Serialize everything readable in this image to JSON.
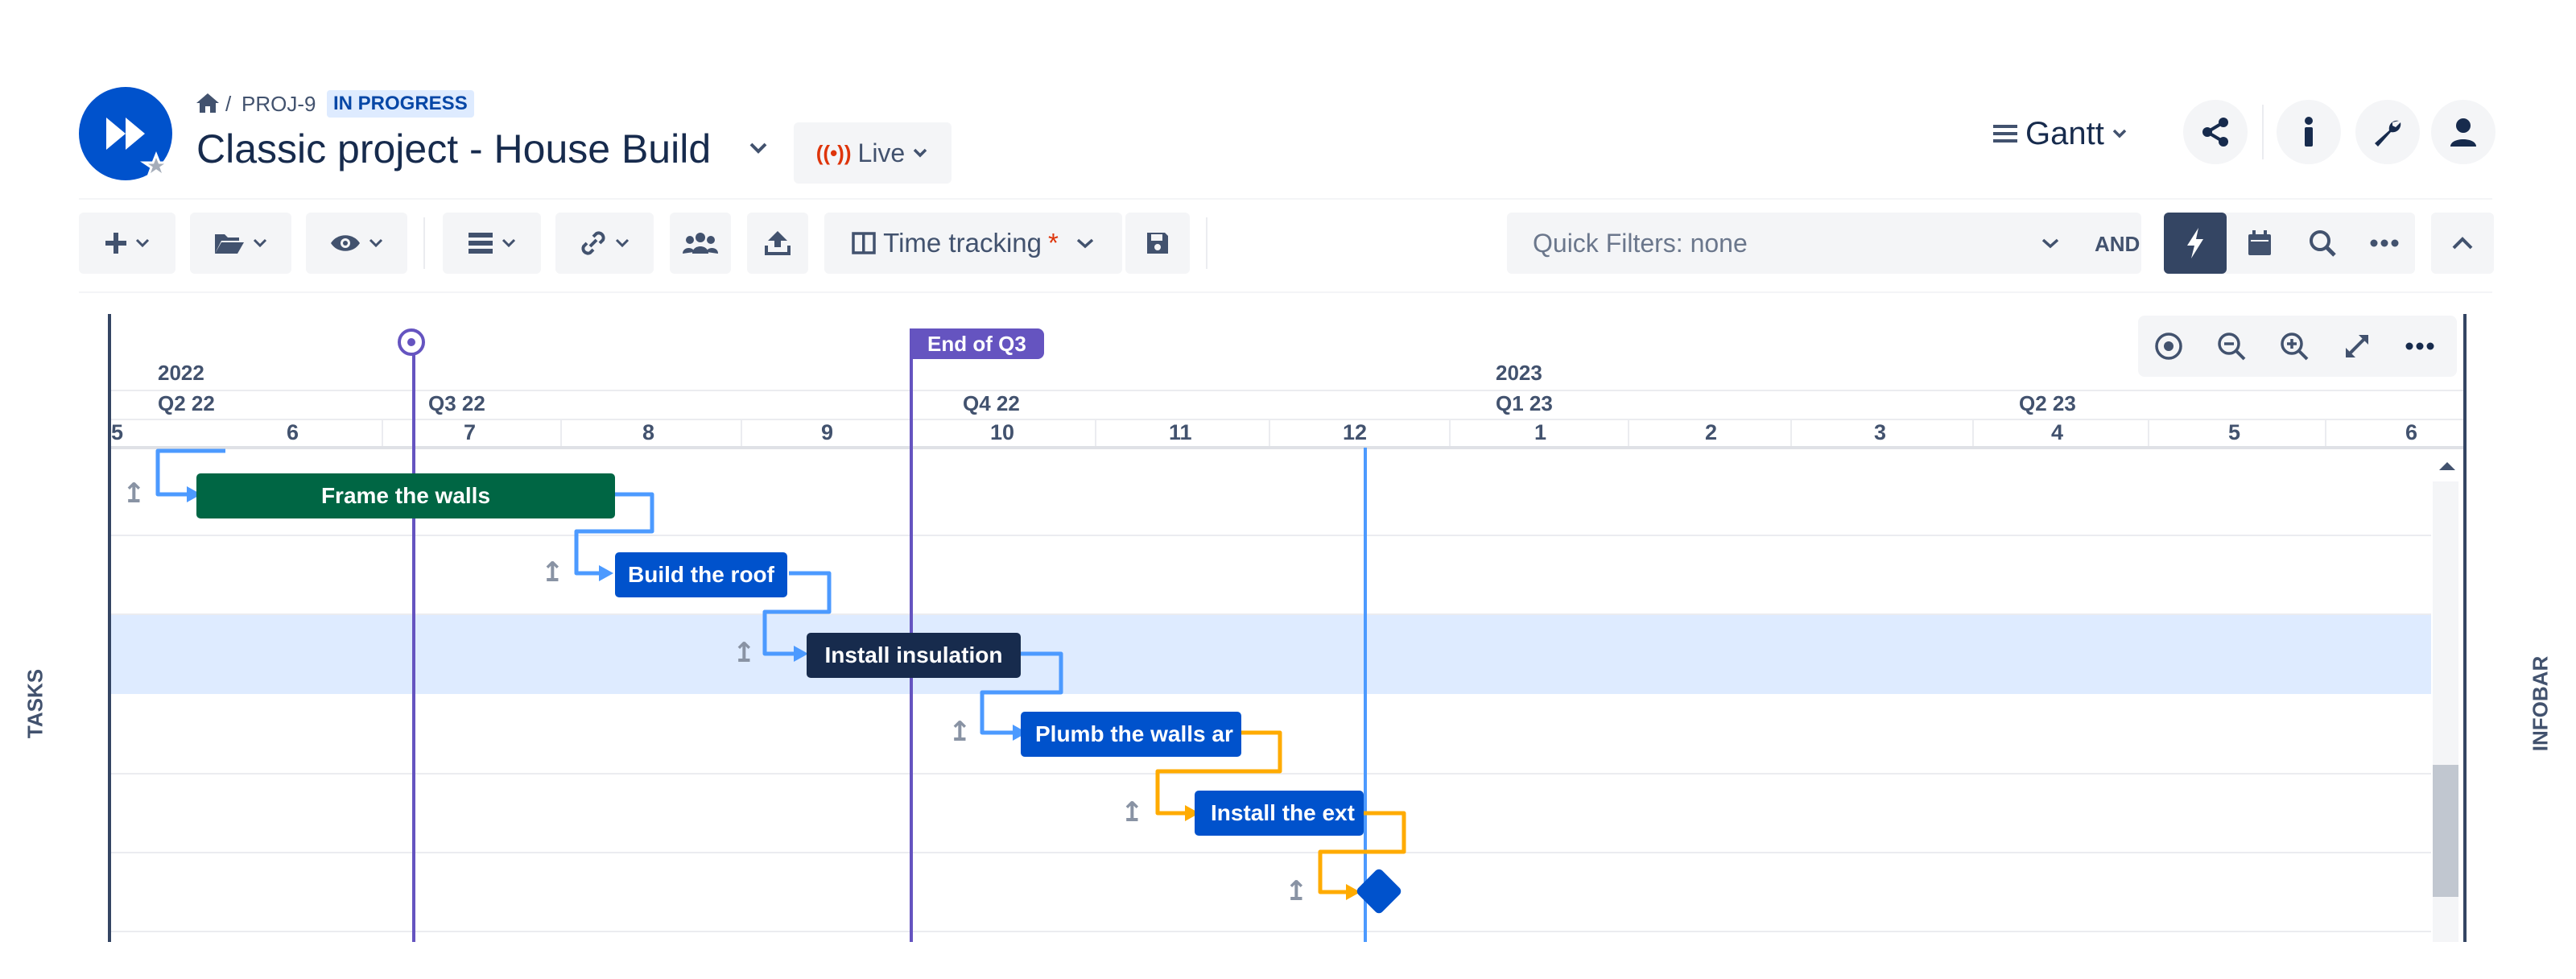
{
  "header": {
    "breadcrumb_sep": "/",
    "project_key": "PROJ-9",
    "status_badge": "IN PROGRESS",
    "project_title": "Classic project - House Build",
    "live_label": "Live",
    "view_label": "Gantt"
  },
  "toolbar": {
    "time_tracking_label": "Time tracking",
    "time_tracking_marker": "*",
    "quick_filters_label": "Quick Filters: none",
    "and_label": "AND"
  },
  "timeline": {
    "years": [
      "2022",
      "2023"
    ],
    "quarters": [
      "Q2 22",
      "Q3 22",
      "Q4 22",
      "Q1 23",
      "Q2 23"
    ],
    "months": [
      "5",
      "6",
      "7",
      "8",
      "9",
      "10",
      "11",
      "12",
      "1",
      "2",
      "3",
      "4",
      "5",
      "6"
    ],
    "marker_label": "End of Q3"
  },
  "side_labels": {
    "left": "TASKS",
    "right": "INFOBAR"
  },
  "tasks": [
    {
      "name": "Frame the walls",
      "color": "#006644"
    },
    {
      "name": "Build the roof",
      "color": "#0052cc"
    },
    {
      "name": "Install insulation",
      "color": "#172b4d"
    },
    {
      "name": "Plumb the walls ar",
      "color": "#0052cc"
    },
    {
      "name": "Install the ext",
      "color": "#0052cc"
    }
  ],
  "colors": {
    "accent_blue": "#0052cc",
    "link_blue": "#4c9aff",
    "link_orange": "#ffab00",
    "marker_purple": "#6554c0",
    "today_line": "#4c9aff",
    "selected_row": "#deebff"
  }
}
